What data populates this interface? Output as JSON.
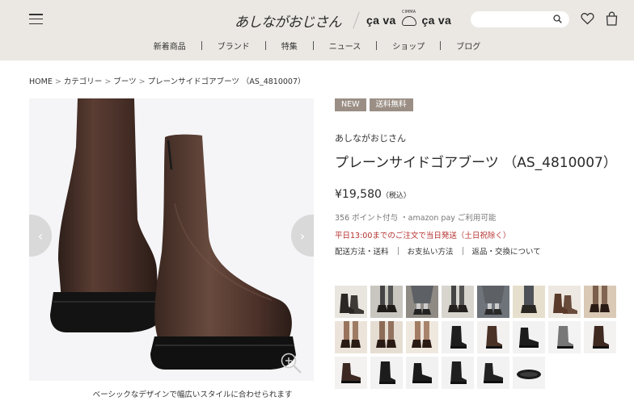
{
  "header": {
    "logo_ashinaga": "あしながおじさん",
    "logo_cava_left": "ça va",
    "logo_cava_right": "ça va",
    "emblem_text": "CIMMA",
    "search_placeholder": "",
    "nav": [
      "新着商品",
      "ブランド",
      "特集",
      "ニュース",
      "ショップ",
      "ブログ"
    ]
  },
  "breadcrumb": [
    "HOME",
    "カテゴリー",
    "ブーツ",
    "プレーンサイドゴアブーツ （AS_4810007）"
  ],
  "product": {
    "badges": [
      "NEW",
      "送料無料"
    ],
    "brand": "あしながおじさん",
    "title": "プレーンサイドゴアブーツ （AS_4810007）",
    "price": "¥19,580",
    "price_tax": "（税込）",
    "points": "356 ポイント付与 ・amazon pay ご利用可能",
    "ship_note": "平日13:00までのご注文で当日発送（土日祝除く）",
    "links": [
      "配送方法・送料",
      "お支払い方法",
      "返品・交換について"
    ],
    "caption": "ベーシックなデザインで幅広いスタイルに合わせられます"
  },
  "thumbnails": [
    {
      "kind": "boots-pair",
      "bg": "#e9e5df",
      "fg": "#2b2724"
    },
    {
      "kind": "legs-dark",
      "bg": "#c9c6c0",
      "fg": "#1f1c1a"
    },
    {
      "kind": "legs-skirt",
      "bg": "#8f8a84",
      "fg": "#222"
    },
    {
      "kind": "legs-dark",
      "bg": "#d8d5cf",
      "fg": "#23201d"
    },
    {
      "kind": "legs-skirt",
      "bg": "#6e747a",
      "fg": "#2a2a2a"
    },
    {
      "kind": "legs-light",
      "bg": "#e6dfcd",
      "fg": "#2a2622"
    },
    {
      "kind": "boots-pair",
      "bg": "#ede8e1",
      "fg": "#5a3a2a"
    },
    {
      "kind": "legs-brown",
      "bg": "#d9c9b5",
      "fg": "#5b3a28"
    },
    {
      "kind": "legs-brown",
      "bg": "#ece4da",
      "fg": "#7d4e31"
    },
    {
      "kind": "legs-brown",
      "bg": "#e6ddd2",
      "fg": "#6e452c"
    },
    {
      "kind": "legs-brown",
      "bg": "#efe8df",
      "fg": "#8a5a3a"
    },
    {
      "kind": "boot-single",
      "bg": "#f1f1f1",
      "fg": "#1e1e1e"
    },
    {
      "kind": "boot-single",
      "bg": "#f3f1ef",
      "fg": "#4a3226"
    },
    {
      "kind": "boot-side",
      "bg": "#f2f2f2",
      "fg": "#1c1c1c"
    },
    {
      "kind": "boot-single",
      "bg": "#f3f3f3",
      "fg": "#777"
    },
    {
      "kind": "boot-single",
      "bg": "#f3f2f1",
      "fg": "#3f2a22"
    },
    {
      "kind": "boot-side",
      "bg": "#f4f2f0",
      "fg": "#3c2a22"
    },
    {
      "kind": "boot-single",
      "bg": "#f2f2f2",
      "fg": "#1c1c1c"
    },
    {
      "kind": "boot-side",
      "bg": "#f1f1f1",
      "fg": "#1a1a1a"
    },
    {
      "kind": "boot-single",
      "bg": "#f2f2f2",
      "fg": "#202020"
    },
    {
      "kind": "boot-side",
      "bg": "#f2f2f2",
      "fg": "#222"
    },
    {
      "kind": "sole",
      "bg": "#f3f3f3",
      "fg": "#1b1b1b"
    }
  ],
  "colors": {
    "header_bg": "#ebe8e3",
    "badge_bg": "#9b8f85",
    "ship_note": "#b5312f",
    "boot_main": "#3e2a24"
  }
}
